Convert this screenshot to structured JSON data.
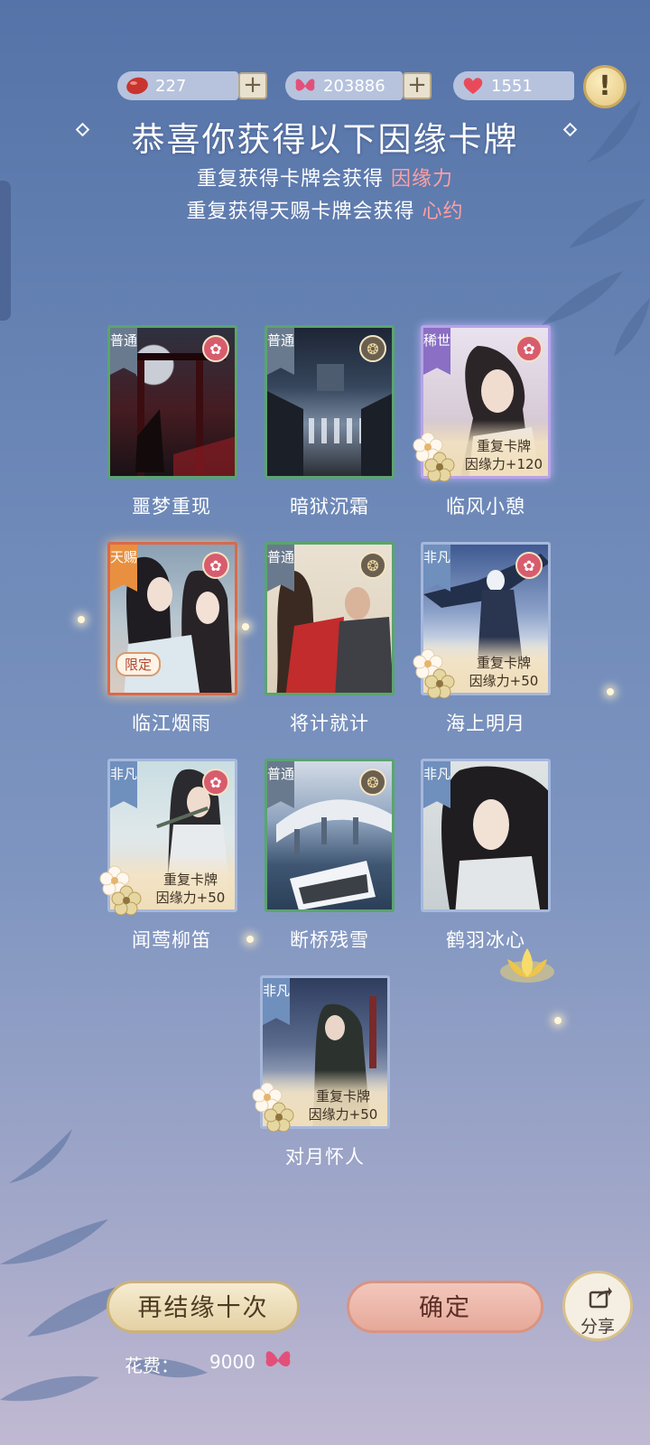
{
  "currencies": [
    {
      "name": "red-bean",
      "value": "227",
      "color": "#c8352f"
    },
    {
      "name": "butterfly",
      "value": "203886",
      "color": "#e2507a"
    },
    {
      "name": "heart",
      "value": "1551",
      "color": "#e94a5b"
    }
  ],
  "plus_label": "+",
  "alert_label": "!",
  "headline": "恭喜你获得以下因缘卡牌",
  "sub1": {
    "text": "重复获得卡牌会获得",
    "highlight": "因缘力"
  },
  "sub2": {
    "text": "重复获得天赐卡牌会获得",
    "highlight": "心约"
  },
  "cards": [
    {
      "name": "噩梦重现",
      "tag": "普通",
      "emblem": "red",
      "duplicate": false
    },
    {
      "name": "暗狱沉霜",
      "tag": "普通",
      "emblem": "gold",
      "duplicate": false
    },
    {
      "name": "临风小憩",
      "tag": "稀世",
      "emblem": "red",
      "duplicate": true,
      "dup_line1": "重复卡牌",
      "dup_line2": "因缘力+120"
    },
    {
      "name": "临江烟雨",
      "tag": "天赐",
      "emblem": "red",
      "duplicate": false,
      "badge": "限定"
    },
    {
      "name": "将计就计",
      "tag": "普通",
      "emblem": "gold",
      "duplicate": false
    },
    {
      "name": "海上明月",
      "tag": "非凡",
      "emblem": "red",
      "duplicate": true,
      "dup_line1": "重复卡牌",
      "dup_line2": "因缘力+50"
    },
    {
      "name": "闻莺柳笛",
      "tag": "非凡",
      "emblem": "red",
      "duplicate": true,
      "dup_line1": "重复卡牌",
      "dup_line2": "因缘力+50"
    },
    {
      "name": "断桥残雪",
      "tag": "普通",
      "emblem": "gold",
      "duplicate": false
    },
    {
      "name": "鹤羽冰心",
      "tag": "非凡",
      "emblem": "none",
      "duplicate": false
    },
    {
      "name": "对月怀人",
      "tag": "非凡",
      "emblem": "none",
      "duplicate": true,
      "dup_line1": "重复卡牌",
      "dup_line2": "因缘力+50"
    }
  ],
  "buttons": {
    "again": "再结缘十次",
    "ok": "确定",
    "share": "分享"
  },
  "cost": {
    "label": "花费：",
    "value": "9000"
  }
}
